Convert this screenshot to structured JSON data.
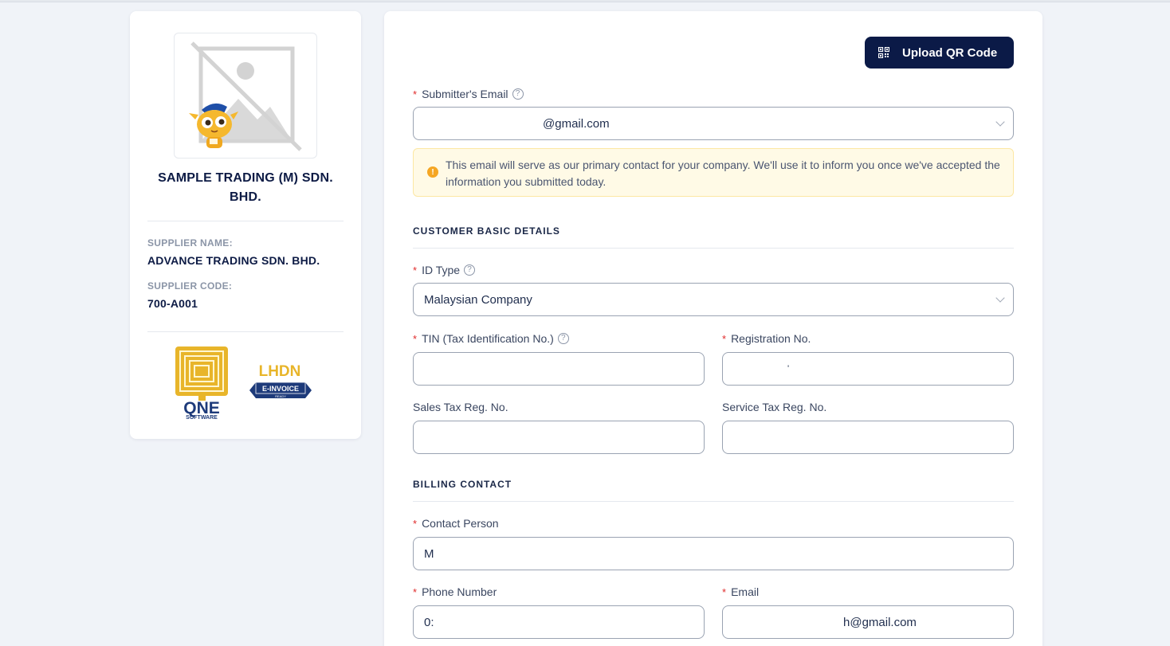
{
  "sidebar": {
    "company_name": "SAMPLE TRADING (M) SDN. BHD.",
    "supplier_name_label": "SUPPLIER NAME:",
    "supplier_name": "ADVANCE TRADING SDN. BHD.",
    "supplier_code_label": "SUPPLIER CODE:",
    "supplier_code": "700-A001",
    "qne_logo_text": "QNE",
    "qne_logo_sub": "SOFTWARE",
    "lhdn_logo_text": "LHDN",
    "lhdn_logo_ribbon": "E-INVOICE",
    "lhdn_logo_sub": "READY"
  },
  "toolbar": {
    "upload_label": "Upload QR Code"
  },
  "form": {
    "submitter_email_label": "Submitter's Email",
    "submitter_email_value": "@gmail.com",
    "notice": "This email will serve as our primary contact for your company. We'll use it to inform you once we've accepted the information you submitted today.",
    "customer_section": "CUSTOMER BASIC DETAILS",
    "id_type_label": "ID Type",
    "id_type_value": "Malaysian Company",
    "tin_label": "TIN (Tax Identification No.)",
    "tin_value": "",
    "reg_no_label": "Registration No.",
    "reg_no_value": "'",
    "sales_tax_label": "Sales Tax Reg. No.",
    "sales_tax_value": "",
    "service_tax_label": "Service Tax Reg. No.",
    "service_tax_value": "",
    "billing_section": "BILLING CONTACT",
    "contact_person_label": "Contact Person",
    "contact_person_value": "M",
    "phone_label": "Phone Number",
    "phone_value": "0:",
    "email_label": "Email",
    "email_value": "h@gmail.com"
  },
  "colors": {
    "accent": "#0b1a47",
    "required": "#e02b2b",
    "notice_bg": "#fffae6",
    "warning": "#f5a623",
    "qne_gold": "#e8b52a",
    "qne_navy": "#1d3a7a"
  },
  "icons": [
    "placeholder-image-icon",
    "mascot-icon",
    "qr-code-icon",
    "help-circle-icon",
    "warning-icon",
    "chevron-down-icon"
  ]
}
